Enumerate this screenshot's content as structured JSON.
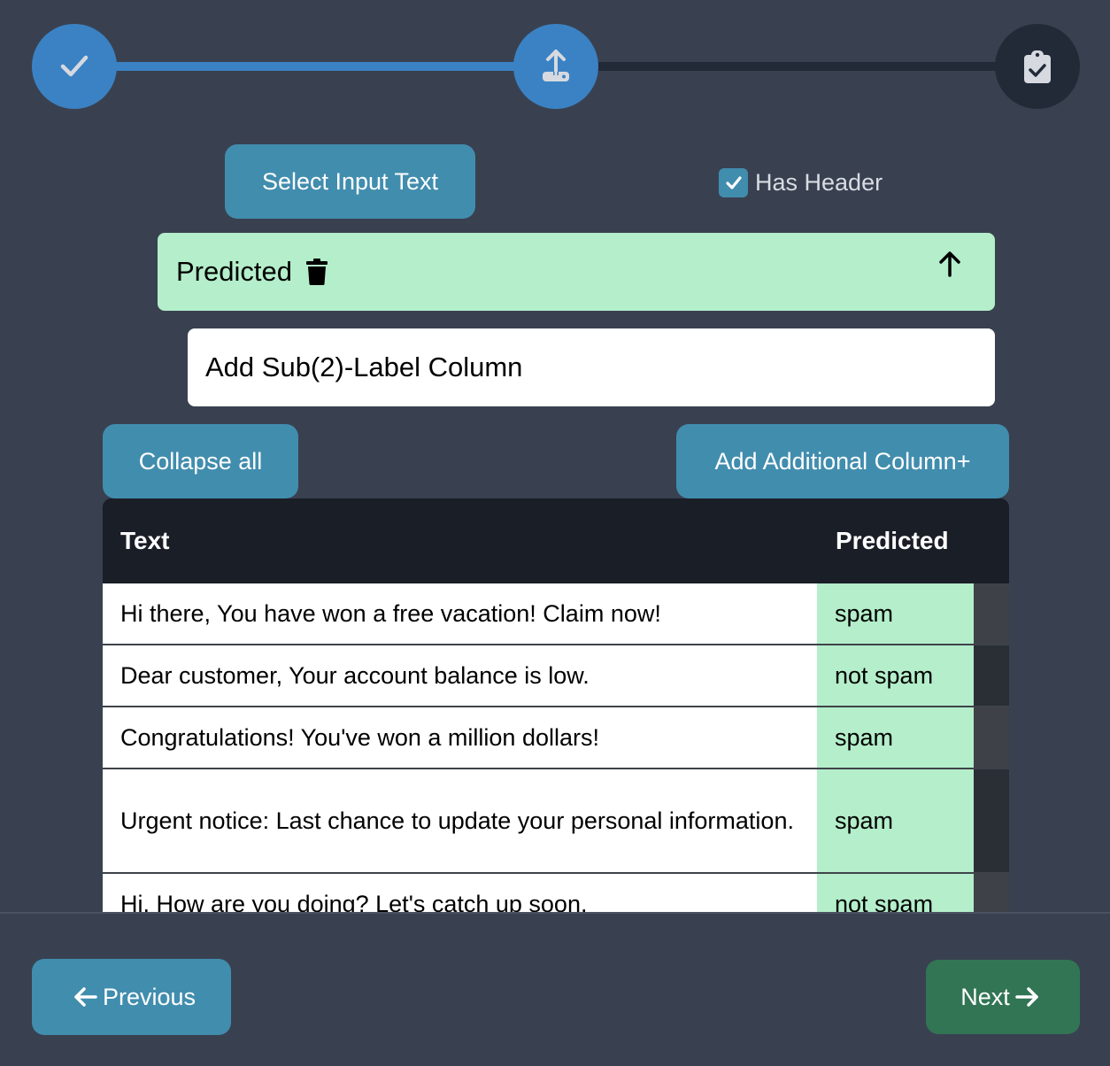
{
  "stepper": {
    "steps": [
      {
        "icon": "check-icon",
        "state": "completed"
      },
      {
        "icon": "upload-icon",
        "state": "active"
      },
      {
        "icon": "clipboard-check-icon",
        "state": "pending"
      }
    ],
    "colors": {
      "active": "#3b82c4",
      "pending": "#222a38"
    }
  },
  "toolbar": {
    "select_input_label": "Select Input Text",
    "has_header_label": "Has Header",
    "has_header_checked": true
  },
  "label_column": {
    "name": "Predicted",
    "delete_icon": "trash-icon",
    "collapse_icon": "arrow-up-icon"
  },
  "sublabel_input": {
    "placeholder": "Add Sub(2)-Label Column"
  },
  "actions": {
    "collapse_all_label": "Collapse all",
    "add_column_label": "Add Additional Column+"
  },
  "table": {
    "columns": [
      "Text",
      "Predicted"
    ],
    "rows": [
      {
        "text": "Hi there, You have won a free vacation! Claim now!",
        "predicted": "spam"
      },
      {
        "text": "Dear customer, Your account balance is low.",
        "predicted": "not spam"
      },
      {
        "text": "Congratulations! You've won a million dollars!",
        "predicted": "spam"
      },
      {
        "text": "Urgent notice: Last chance to update your personal information.",
        "predicted": "spam"
      },
      {
        "text": "Hi, How are you doing? Let's catch up soon.",
        "predicted": "not spam"
      }
    ]
  },
  "footer": {
    "previous_label": "Previous",
    "next_label": "Next"
  },
  "colors": {
    "background": "#394150",
    "button_blue": "#418dae",
    "button_green": "#327554",
    "label_green": "#b4eeca",
    "table_header": "#1a1e27"
  }
}
